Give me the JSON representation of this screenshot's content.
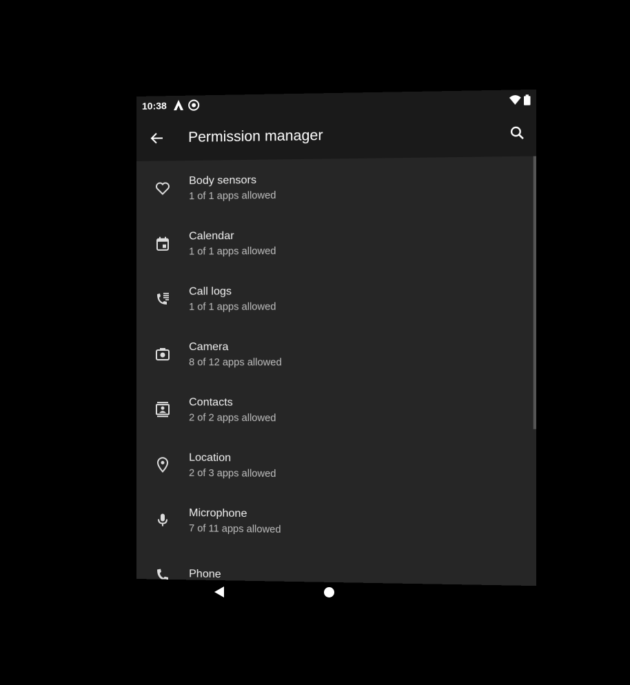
{
  "status_bar": {
    "time": "10:38"
  },
  "app_bar": {
    "title": "Permission manager"
  },
  "permissions": [
    {
      "label": "Body sensors",
      "summary": "1 of 1 apps allowed",
      "icon": "heart-icon"
    },
    {
      "label": "Calendar",
      "summary": "1 of 1 apps allowed",
      "icon": "calendar-icon"
    },
    {
      "label": "Call logs",
      "summary": "1 of 1 apps allowed",
      "icon": "call-log-icon"
    },
    {
      "label": "Camera",
      "summary": "8 of 12 apps allowed",
      "icon": "camera-icon"
    },
    {
      "label": "Contacts",
      "summary": "2 of 2 apps allowed",
      "icon": "contacts-icon"
    },
    {
      "label": "Location",
      "summary": "2 of 3 apps allowed",
      "icon": "location-pin-icon"
    },
    {
      "label": "Microphone",
      "summary": "7 of 11 apps allowed",
      "icon": "microphone-icon"
    },
    {
      "label": "Phone",
      "summary": "",
      "icon": "phone-icon"
    }
  ],
  "colors": {
    "background": "#000000",
    "app_bar": "#1a1a1a",
    "list": "#262626",
    "text": "#f0f0f0",
    "subtext": "#bdbdbd"
  }
}
